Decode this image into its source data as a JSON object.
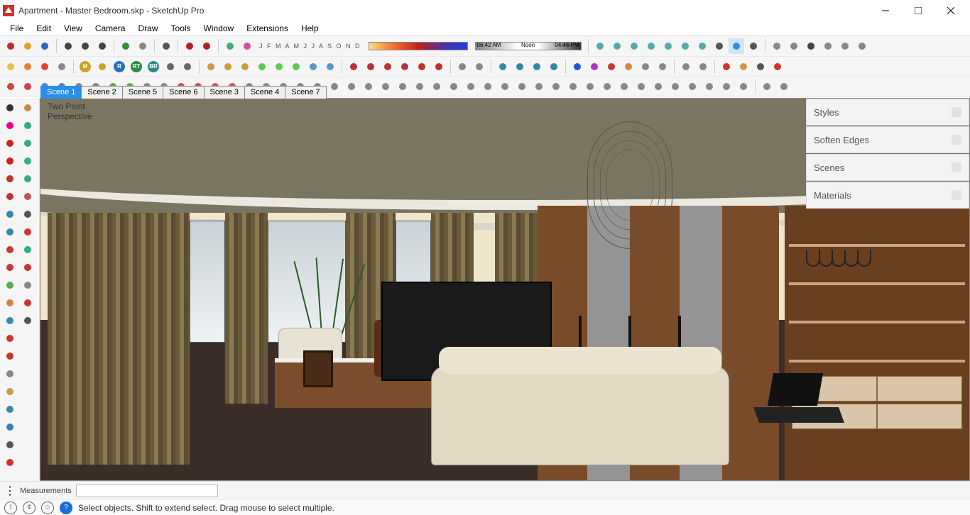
{
  "title": "Apartment - Master Bedroom.skp - SketchUp Pro",
  "menus": [
    "File",
    "Edit",
    "View",
    "Camera",
    "Draw",
    "Tools",
    "Window",
    "Extensions",
    "Help"
  ],
  "months": "J F M A M J J A S O N D",
  "shadow_times": {
    "t1": "06:42 AM",
    "t2": "Noon",
    "t3": "04:46 PM"
  },
  "scenes": [
    "Scene 1",
    "Scene 2",
    "Scene 5",
    "Scene 6",
    "Scene 3",
    "Scene 4",
    "Scene 7"
  ],
  "active_scene": 0,
  "view_label_line1": "Two Point",
  "view_label_line2": "Perspective",
  "trays": [
    "Styles",
    "Soften Edges",
    "Scenes",
    "Materials"
  ],
  "measurements_label": "Measurements",
  "status_text": "Select objects. Shift to extend select. Drag mouse to select multiple.",
  "left_tools": [
    "select",
    "eraser",
    "line",
    "freehand",
    "rectangle",
    "rect-rot",
    "circle",
    "polygon",
    "arc",
    "arc2",
    "pushpull",
    "follow",
    "offset",
    "move",
    "rotate",
    "scale",
    "tape",
    "protractor",
    "dimension",
    "text",
    "axes",
    "section",
    "orbit",
    "pan",
    "zoom",
    "zoom-ext",
    "paint",
    "3dtext",
    "walk",
    "look",
    "position",
    "sandbox",
    "foot",
    "eye"
  ],
  "toolbar_row1": [
    {
      "n": "new",
      "c": "#c62828"
    },
    {
      "n": "open",
      "c": "#e0a030"
    },
    {
      "n": "save",
      "c": "#3060c0"
    },
    {
      "sep": true
    },
    {
      "n": "cut",
      "c": "#444"
    },
    {
      "n": "copy",
      "c": "#444"
    },
    {
      "n": "paste",
      "c": "#444"
    },
    {
      "sep": true
    },
    {
      "n": "undo",
      "c": "#3a8a3a"
    },
    {
      "n": "redo",
      "c": "#888"
    },
    {
      "sep": true
    },
    {
      "n": "print",
      "c": "#555"
    },
    {
      "sep": true
    },
    {
      "n": "model-a",
      "c": "#b02020"
    },
    {
      "n": "model-b",
      "c": "#b02020"
    },
    {
      "sep": true
    },
    {
      "n": "layer",
      "c": "#4a7"
    },
    {
      "n": "paint",
      "c": "#c59"
    }
  ],
  "toolbar_row1b": [
    {
      "n": "iso",
      "c": "#5aa"
    },
    {
      "n": "top",
      "c": "#5aa"
    },
    {
      "n": "front",
      "c": "#5aa"
    },
    {
      "n": "right",
      "c": "#5aa"
    },
    {
      "n": "back",
      "c": "#5aa"
    },
    {
      "n": "left",
      "c": "#5aa"
    },
    {
      "n": "bottom",
      "c": "#5aa"
    },
    {
      "n": "style-mono",
      "c": "#555"
    },
    {
      "n": "style-tex",
      "c": "#2b8fe6",
      "active": true
    },
    {
      "n": "style-xray",
      "c": "#555"
    },
    {
      "sep": true
    },
    {
      "n": "wh-a",
      "c": "#888"
    },
    {
      "n": "wh-b",
      "c": "#888"
    },
    {
      "n": "wh-home",
      "c": "#444"
    },
    {
      "n": "wh-c",
      "c": "#888"
    },
    {
      "n": "wh-d",
      "c": "#888"
    },
    {
      "n": "wh-e",
      "c": "#888"
    }
  ],
  "toolbar_row2": [
    {
      "n": "sun-y",
      "c": "#e6c040"
    },
    {
      "n": "sun-o",
      "c": "#e68030"
    },
    {
      "n": "sun-r",
      "c": "#e04030"
    },
    {
      "n": "sun-hide",
      "c": "#888"
    },
    {
      "sep": true
    },
    {
      "n": "m",
      "c": "#c9a227",
      "t": "M"
    },
    {
      "n": "lock",
      "c": "#c9a227"
    },
    {
      "n": "r",
      "c": "#2a70c0",
      "t": "R"
    },
    {
      "n": "rt",
      "c": "#2a8a4a",
      "t": "RT"
    },
    {
      "n": "br",
      "c": "#2a8a8a",
      "t": "BR"
    },
    {
      "n": "gear",
      "c": "#666"
    },
    {
      "n": "info",
      "c": "#666"
    },
    {
      "sep": true
    },
    {
      "n": "sb1",
      "c": "#c94"
    },
    {
      "n": "sb2",
      "c": "#c94"
    },
    {
      "n": "sb3",
      "c": "#c94"
    },
    {
      "n": "sb4",
      "c": "#5c5"
    },
    {
      "n": "sb5",
      "c": "#5c5"
    },
    {
      "n": "sb6",
      "c": "#5c5"
    },
    {
      "n": "sb7",
      "c": "#59c"
    },
    {
      "n": "sb8",
      "c": "#59c"
    },
    {
      "sep": true
    },
    {
      "n": "sel1",
      "c": "#b33"
    },
    {
      "n": "sel2",
      "c": "#b33"
    },
    {
      "n": "sel3",
      "c": "#b33"
    },
    {
      "n": "sel4",
      "c": "#b33"
    },
    {
      "n": "sel5",
      "c": "#b33"
    },
    {
      "n": "sel6",
      "c": "#b33"
    },
    {
      "sep": true
    },
    {
      "n": "pl1",
      "c": "#888"
    },
    {
      "n": "pl2",
      "c": "#888"
    },
    {
      "sep": true
    },
    {
      "n": "cam1",
      "c": "#38a"
    },
    {
      "n": "cam2",
      "c": "#38a"
    },
    {
      "n": "cam3",
      "c": "#38a"
    },
    {
      "n": "cam4",
      "c": "#38a"
    },
    {
      "sep": true
    },
    {
      "n": "ln1",
      "c": "#25d"
    },
    {
      "n": "ln2",
      "c": "#a3c"
    },
    {
      "n": "ln3",
      "c": "#c33"
    },
    {
      "n": "ln4",
      "c": "#c84"
    },
    {
      "n": "ln5",
      "c": "#888"
    },
    {
      "n": "ln6",
      "c": "#888"
    },
    {
      "sep": true
    },
    {
      "n": "grp1",
      "c": "#888"
    },
    {
      "n": "grp2",
      "c": "#888"
    },
    {
      "sep": true
    },
    {
      "n": "ax1",
      "c": "#c33"
    },
    {
      "n": "ax2",
      "c": "#c94"
    },
    {
      "n": "ax3",
      "c": "#555"
    },
    {
      "n": "ax4",
      "c": "#c33"
    }
  ],
  "toolbar_row3": [
    {
      "n": "t1",
      "c": "#c44"
    },
    {
      "n": "t2",
      "c": "#c44"
    },
    {
      "n": "t3",
      "c": "#48c"
    },
    {
      "n": "t4",
      "c": "#48c"
    },
    {
      "n": "t5",
      "c": "#888"
    },
    {
      "n": "t6",
      "c": "#888"
    },
    {
      "n": "t7",
      "c": "#6a4"
    },
    {
      "n": "t8",
      "c": "#6a4"
    },
    {
      "n": "t9",
      "c": "#888"
    },
    {
      "n": "t10",
      "c": "#888"
    },
    {
      "n": "t11",
      "c": "#c55"
    },
    {
      "n": "t12",
      "c": "#c55"
    },
    {
      "n": "t13",
      "c": "#c55"
    },
    {
      "n": "t14",
      "c": "#c55"
    },
    {
      "n": "t15",
      "c": "#888"
    },
    {
      "n": "t16",
      "c": "#888"
    },
    {
      "n": "t17",
      "c": "#888"
    },
    {
      "n": "t18",
      "c": "#888"
    },
    {
      "n": "t19",
      "c": "#888"
    },
    {
      "n": "t20",
      "c": "#888"
    },
    {
      "n": "t21",
      "c": "#888"
    },
    {
      "n": "t22",
      "c": "#888"
    },
    {
      "n": "t23",
      "c": "#888"
    },
    {
      "n": "t24",
      "c": "#888"
    },
    {
      "n": "t25",
      "c": "#888"
    },
    {
      "n": "t26",
      "c": "#888"
    },
    {
      "n": "t27",
      "c": "#888"
    },
    {
      "n": "t28",
      "c": "#888"
    },
    {
      "n": "t29",
      "c": "#888"
    },
    {
      "n": "t30",
      "c": "#888"
    },
    {
      "n": "t31",
      "c": "#888"
    },
    {
      "n": "t32",
      "c": "#888"
    },
    {
      "n": "t33",
      "c": "#888"
    },
    {
      "n": "t34",
      "c": "#888"
    },
    {
      "n": "t35",
      "c": "#888"
    },
    {
      "n": "t36",
      "c": "#888"
    },
    {
      "n": "t37",
      "c": "#888"
    },
    {
      "n": "t38",
      "c": "#888"
    },
    {
      "n": "t39",
      "c": "#888"
    },
    {
      "n": "t40",
      "c": "#888"
    },
    {
      "n": "t41",
      "c": "#888"
    },
    {
      "n": "t42",
      "c": "#888"
    },
    {
      "n": "t43",
      "c": "#888"
    },
    {
      "n": "t44",
      "c": "#888"
    },
    {
      "sep": true
    },
    {
      "n": "t45",
      "c": "#888"
    },
    {
      "n": "t46",
      "c": "#888"
    }
  ]
}
